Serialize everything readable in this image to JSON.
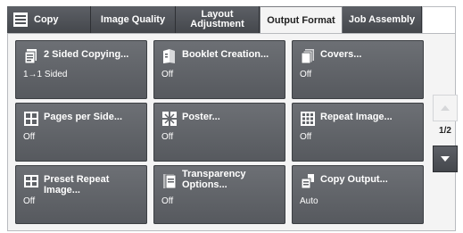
{
  "tabs": [
    {
      "label": "Copy"
    },
    {
      "label": "Image Quality"
    },
    {
      "label": "Layout\nAdjustment"
    },
    {
      "label": "Output Format"
    },
    {
      "label": "Job Assembly"
    }
  ],
  "active_tab": "Output Format",
  "tiles": [
    {
      "title": "2 Sided Copying...",
      "value": "1→1 Sided",
      "icon": "two-sided-copy-icon"
    },
    {
      "title": "Booklet Creation...",
      "value": "Off",
      "icon": "booklet-icon"
    },
    {
      "title": "Covers...",
      "value": "Off",
      "icon": "covers-icon"
    },
    {
      "title": "Pages per Side...",
      "value": "Off",
      "icon": "pages-per-side-icon"
    },
    {
      "title": "Poster...",
      "value": "Off",
      "icon": "poster-icon"
    },
    {
      "title": "Repeat Image...",
      "value": "Off",
      "icon": "repeat-image-icon"
    },
    {
      "title": "Preset Repeat Image...",
      "value": "Off",
      "icon": "preset-repeat-image-icon"
    },
    {
      "title": "Transparency\nOptions...",
      "value": "Off",
      "icon": "transparency-icon"
    },
    {
      "title": "Copy Output...",
      "value": "Auto",
      "icon": "copy-output-icon"
    }
  ],
  "pager": {
    "label": "1/2"
  },
  "colors": {
    "tile": "#5e6166",
    "tab": "#4e5156",
    "panel": "#f4f4f4"
  }
}
